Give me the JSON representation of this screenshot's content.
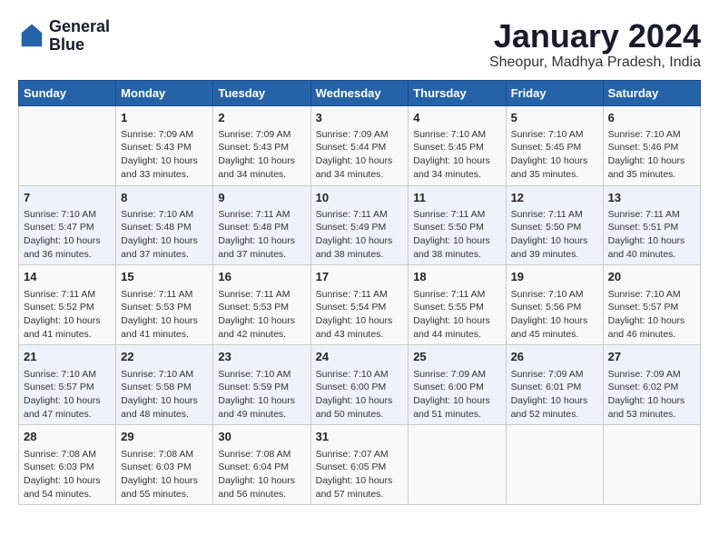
{
  "logo": {
    "line1": "General",
    "line2": "Blue"
  },
  "title": "January 2024",
  "subtitle": "Sheopur, Madhya Pradesh, India",
  "days_of_week": [
    "Sunday",
    "Monday",
    "Tuesday",
    "Wednesday",
    "Thursday",
    "Friday",
    "Saturday"
  ],
  "weeks": [
    [
      {
        "num": "",
        "info": ""
      },
      {
        "num": "1",
        "info": "Sunrise: 7:09 AM\nSunset: 5:43 PM\nDaylight: 10 hours\nand 33 minutes."
      },
      {
        "num": "2",
        "info": "Sunrise: 7:09 AM\nSunset: 5:43 PM\nDaylight: 10 hours\nand 34 minutes."
      },
      {
        "num": "3",
        "info": "Sunrise: 7:09 AM\nSunset: 5:44 PM\nDaylight: 10 hours\nand 34 minutes."
      },
      {
        "num": "4",
        "info": "Sunrise: 7:10 AM\nSunset: 5:45 PM\nDaylight: 10 hours\nand 34 minutes."
      },
      {
        "num": "5",
        "info": "Sunrise: 7:10 AM\nSunset: 5:45 PM\nDaylight: 10 hours\nand 35 minutes."
      },
      {
        "num": "6",
        "info": "Sunrise: 7:10 AM\nSunset: 5:46 PM\nDaylight: 10 hours\nand 35 minutes."
      }
    ],
    [
      {
        "num": "7",
        "info": "Sunrise: 7:10 AM\nSunset: 5:47 PM\nDaylight: 10 hours\nand 36 minutes."
      },
      {
        "num": "8",
        "info": "Sunrise: 7:10 AM\nSunset: 5:48 PM\nDaylight: 10 hours\nand 37 minutes."
      },
      {
        "num": "9",
        "info": "Sunrise: 7:11 AM\nSunset: 5:48 PM\nDaylight: 10 hours\nand 37 minutes."
      },
      {
        "num": "10",
        "info": "Sunrise: 7:11 AM\nSunset: 5:49 PM\nDaylight: 10 hours\nand 38 minutes."
      },
      {
        "num": "11",
        "info": "Sunrise: 7:11 AM\nSunset: 5:50 PM\nDaylight: 10 hours\nand 38 minutes."
      },
      {
        "num": "12",
        "info": "Sunrise: 7:11 AM\nSunset: 5:50 PM\nDaylight: 10 hours\nand 39 minutes."
      },
      {
        "num": "13",
        "info": "Sunrise: 7:11 AM\nSunset: 5:51 PM\nDaylight: 10 hours\nand 40 minutes."
      }
    ],
    [
      {
        "num": "14",
        "info": "Sunrise: 7:11 AM\nSunset: 5:52 PM\nDaylight: 10 hours\nand 41 minutes."
      },
      {
        "num": "15",
        "info": "Sunrise: 7:11 AM\nSunset: 5:53 PM\nDaylight: 10 hours\nand 41 minutes."
      },
      {
        "num": "16",
        "info": "Sunrise: 7:11 AM\nSunset: 5:53 PM\nDaylight: 10 hours\nand 42 minutes."
      },
      {
        "num": "17",
        "info": "Sunrise: 7:11 AM\nSunset: 5:54 PM\nDaylight: 10 hours\nand 43 minutes."
      },
      {
        "num": "18",
        "info": "Sunrise: 7:11 AM\nSunset: 5:55 PM\nDaylight: 10 hours\nand 44 minutes."
      },
      {
        "num": "19",
        "info": "Sunrise: 7:10 AM\nSunset: 5:56 PM\nDaylight: 10 hours\nand 45 minutes."
      },
      {
        "num": "20",
        "info": "Sunrise: 7:10 AM\nSunset: 5:57 PM\nDaylight: 10 hours\nand 46 minutes."
      }
    ],
    [
      {
        "num": "21",
        "info": "Sunrise: 7:10 AM\nSunset: 5:57 PM\nDaylight: 10 hours\nand 47 minutes."
      },
      {
        "num": "22",
        "info": "Sunrise: 7:10 AM\nSunset: 5:58 PM\nDaylight: 10 hours\nand 48 minutes."
      },
      {
        "num": "23",
        "info": "Sunrise: 7:10 AM\nSunset: 5:59 PM\nDaylight: 10 hours\nand 49 minutes."
      },
      {
        "num": "24",
        "info": "Sunrise: 7:10 AM\nSunset: 6:00 PM\nDaylight: 10 hours\nand 50 minutes."
      },
      {
        "num": "25",
        "info": "Sunrise: 7:09 AM\nSunset: 6:00 PM\nDaylight: 10 hours\nand 51 minutes."
      },
      {
        "num": "26",
        "info": "Sunrise: 7:09 AM\nSunset: 6:01 PM\nDaylight: 10 hours\nand 52 minutes."
      },
      {
        "num": "27",
        "info": "Sunrise: 7:09 AM\nSunset: 6:02 PM\nDaylight: 10 hours\nand 53 minutes."
      }
    ],
    [
      {
        "num": "28",
        "info": "Sunrise: 7:08 AM\nSunset: 6:03 PM\nDaylight: 10 hours\nand 54 minutes."
      },
      {
        "num": "29",
        "info": "Sunrise: 7:08 AM\nSunset: 6:03 PM\nDaylight: 10 hours\nand 55 minutes."
      },
      {
        "num": "30",
        "info": "Sunrise: 7:08 AM\nSunset: 6:04 PM\nDaylight: 10 hours\nand 56 minutes."
      },
      {
        "num": "31",
        "info": "Sunrise: 7:07 AM\nSunset: 6:05 PM\nDaylight: 10 hours\nand 57 minutes."
      },
      {
        "num": "",
        "info": ""
      },
      {
        "num": "",
        "info": ""
      },
      {
        "num": "",
        "info": ""
      }
    ]
  ]
}
